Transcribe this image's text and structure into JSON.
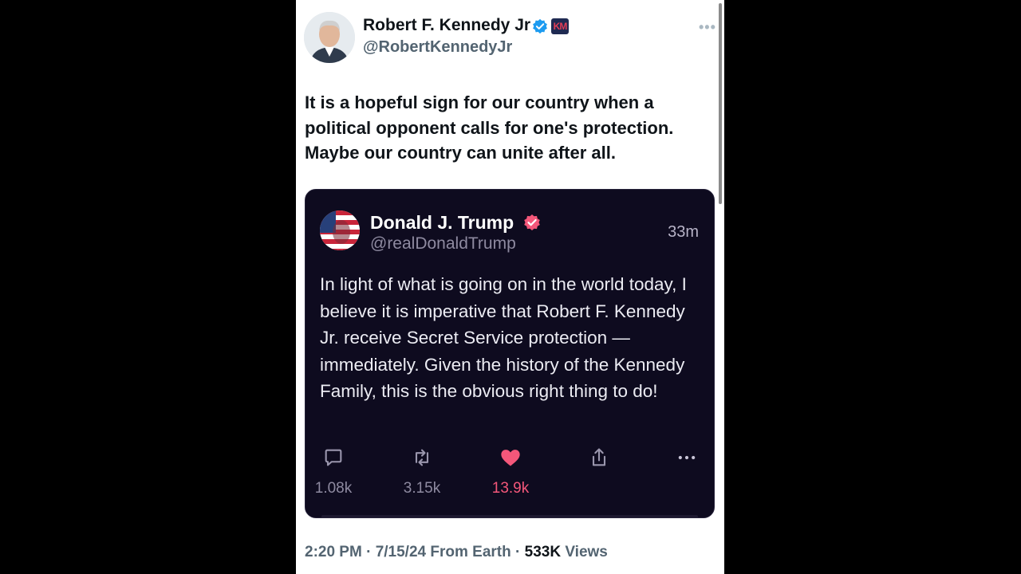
{
  "author": {
    "display_name": "Robert F. Kennedy Jr",
    "handle": "@RobertKennedyJr",
    "badge_text": "KM"
  },
  "tweet": {
    "text": "It is a hopeful sign for our country when a political opponent calls for one's protection. Maybe our country can unite after all."
  },
  "quoted": {
    "display_name": "Donald J. Trump",
    "handle": "@realDonaldTrump",
    "time": "33m",
    "text": "In light of what is going on in the world today, I believe it is imperative that Robert F. Kennedy Jr. receive Secret Service protection — immediately. Given the history of the Kennedy Family, this is the obvious right thing to do!",
    "actions": {
      "replies": "1.08k",
      "reposts": "3.15k",
      "likes": "13.9k"
    }
  },
  "meta": {
    "time": "2:20 PM",
    "date": "7/15/24",
    "source": "From Earth",
    "views": "533K",
    "views_label": "Views"
  },
  "colors": {
    "like": "#f4577a",
    "verified_blue": "#1d9bf0",
    "verified_pink": "#f4577a",
    "quote_bg": "#0e0b1f"
  }
}
